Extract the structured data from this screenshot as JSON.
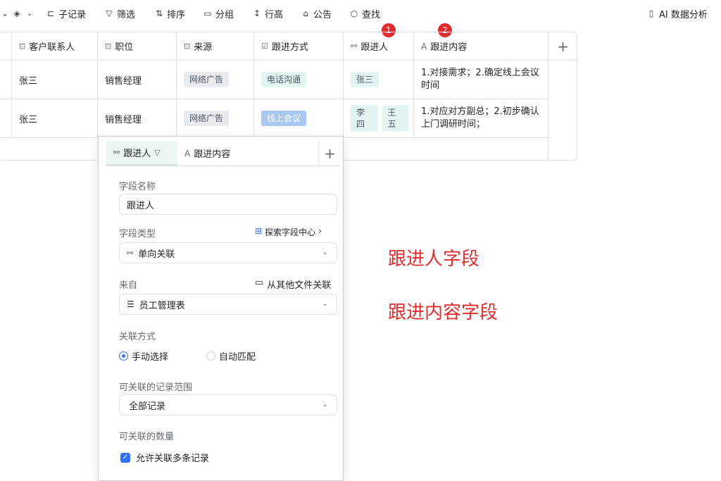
{
  "toolbar": {
    "child_records": "子记录",
    "filter": "筛选",
    "sort": "排序",
    "group": "分组",
    "row_height": "行高",
    "announcement": "公告",
    "find": "查找",
    "ai_analysis": "AI 数据分析"
  },
  "table": {
    "columns": [
      {
        "label": "客户联系人",
        "icon": "text-field-icon"
      },
      {
        "label": "职位",
        "icon": "text-field-icon"
      },
      {
        "label": "来源",
        "icon": "text-field-icon"
      },
      {
        "label": "跟进方式",
        "icon": "single-select-icon"
      },
      {
        "label": "跟进人",
        "icon": "link-icon"
      },
      {
        "label": "跟进内容",
        "icon": "text-icon"
      }
    ],
    "rows": [
      {
        "contact": "张三",
        "position": "销售经理",
        "source": "网络广告",
        "method": "电话沟通",
        "followers": [
          "张三"
        ],
        "content": "1.对接需求；2.确定线上会议时间"
      },
      {
        "contact": "张三",
        "position": "销售经理",
        "source": "网络广告",
        "method": "线上会议",
        "followers": [
          "李四",
          "王五"
        ],
        "content": "1.对应对方副总；2.初步确认上门调研时间；"
      }
    ],
    "add_column": "+"
  },
  "badges": {
    "one": "1",
    "two": "2"
  },
  "popup": {
    "tab_active": "跟进人",
    "tab_other": "跟进内容",
    "tab_add": "+",
    "field_name_label": "字段名称",
    "field_name_value": "跟进人",
    "field_type_label": "字段类型",
    "explore_link": "探索字段中心",
    "field_type_value": "单向关联",
    "from_label": "来自",
    "other_file_link": "从其他文件关联",
    "from_value": "员工管理表",
    "relation_label": "关联方式",
    "manual": "手动选择",
    "auto": "自动匹配",
    "range_label": "可关联的记录范围",
    "range_value": "全部记录",
    "count_label": "可关联的数量",
    "allow_multiple": "允许关联多条记录",
    "allow_multiple_checked": true
  },
  "annotations": {
    "a1": "跟进人字段",
    "a2": "跟进内容字段"
  },
  "colors": {
    "accent": "#3370ff",
    "annotation": "#e22b2b"
  }
}
